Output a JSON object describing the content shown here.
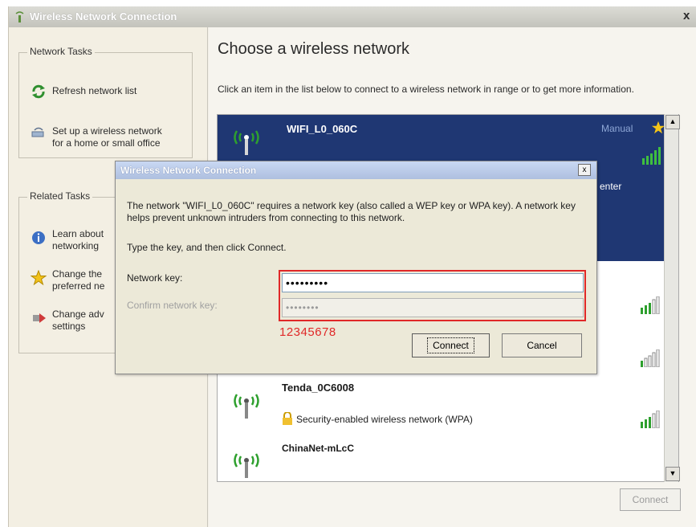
{
  "window": {
    "title": "Wireless Network Connection",
    "close": "x"
  },
  "left": {
    "network_tasks": {
      "heading": "Network Tasks",
      "items": [
        "Refresh network list",
        "Set up a wireless network",
        "for a home or small office"
      ]
    },
    "related_tasks": {
      "heading": "Related Tasks",
      "items": [
        {
          "line1": "Learn about",
          "line2": "networking"
        },
        {
          "line1": "Change the",
          "line2": "preferred ne"
        },
        {
          "line1": "Change adv",
          "line2": "settings"
        }
      ]
    }
  },
  "main": {
    "heading": "Choose a wireless network",
    "instructions": "Click an item in the list below to connect to a wireless network in range or to get more information.",
    "networks": [
      {
        "name": "WIFI_L0_060C",
        "status": "Manual",
        "trailing_text": "enter"
      },
      {
        "name": "Tenda_0C6008",
        "security": "Security-enabled wireless network (WPA)"
      },
      {
        "name": "ChinaNet-mLcC"
      }
    ],
    "connect_label": "Connect"
  },
  "dialog": {
    "title": "Wireless Network Connection",
    "close": "x",
    "message": "The network \"WIFI_L0_060C\" requires a network key (also called a WEP key or WPA key). A network key helps prevent unknown intruders from connecting to this network.",
    "type_instruction": "Type the key, and then click Connect.",
    "network_key_label": "Network key:",
    "network_key_value": "•••••••••",
    "confirm_label": "Confirm network key:",
    "confirm_value": "••••••••",
    "annotation": "12345678",
    "connect_label": "Connect",
    "cancel_label": "Cancel"
  },
  "colors": {
    "selected_row": "#1f3773",
    "annotation_red": "#e02828",
    "signal_green": "#2ea02e"
  }
}
